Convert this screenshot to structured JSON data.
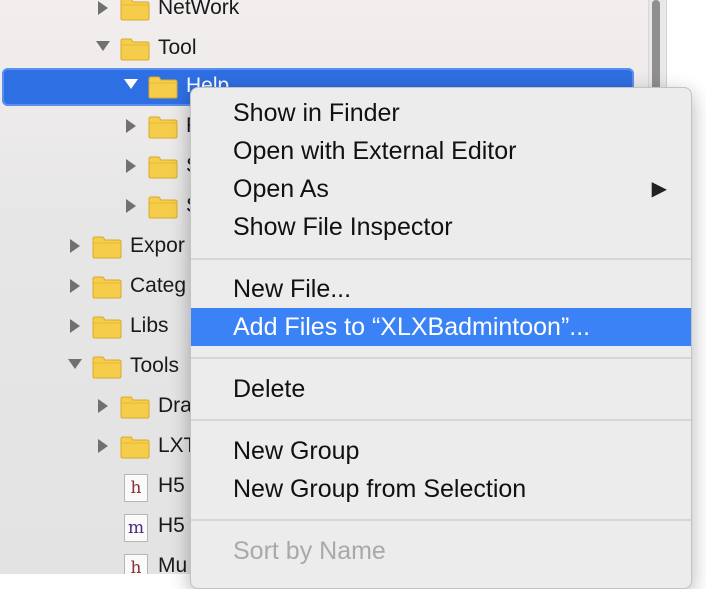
{
  "navigator": {
    "rows": [
      {
        "label": "NetWork",
        "kind": "folder",
        "expanded": false
      },
      {
        "label": "Tool",
        "kind": "folder",
        "expanded": true
      },
      {
        "label": "Help",
        "kind": "folder",
        "expanded": true,
        "selected": true
      },
      {
        "label": "F",
        "kind": "folder",
        "expanded": false
      },
      {
        "label": "S",
        "kind": "folder",
        "expanded": false
      },
      {
        "label": "S",
        "kind": "folder",
        "expanded": false
      },
      {
        "label": "Expor",
        "kind": "folder",
        "expanded": false
      },
      {
        "label": "Categ",
        "kind": "folder",
        "expanded": false
      },
      {
        "label": "Libs",
        "kind": "folder",
        "expanded": false
      },
      {
        "label": "Tools",
        "kind": "folder",
        "expanded": true
      },
      {
        "label": "Dra",
        "kind": "folder",
        "expanded": false
      },
      {
        "label": "LXT",
        "kind": "folder",
        "expanded": false
      },
      {
        "label": "H5",
        "kind": "file",
        "file_letter": "h"
      },
      {
        "label": "H5",
        "kind": "file",
        "file_letter": "m"
      },
      {
        "label": "Mu",
        "kind": "file",
        "file_letter": "h"
      }
    ]
  },
  "context_menu": {
    "items": [
      {
        "label": "Show in Finder"
      },
      {
        "label": "Open with External Editor"
      },
      {
        "label": "Open As",
        "submenu_arrow": "▶"
      },
      {
        "label": "Show File Inspector"
      },
      {
        "label": "New File..."
      },
      {
        "label": "Add Files to “XLXBadmintoon”...",
        "highlighted": true
      },
      {
        "label": "Delete"
      },
      {
        "label": "New Group"
      },
      {
        "label": "New Group from Selection"
      },
      {
        "label": "Sort by Name",
        "disabled": true
      }
    ]
  },
  "colors": {
    "selection": "#2e6fe3",
    "menu_highlight": "#3a82f6",
    "folder": "#f6cd4a"
  }
}
